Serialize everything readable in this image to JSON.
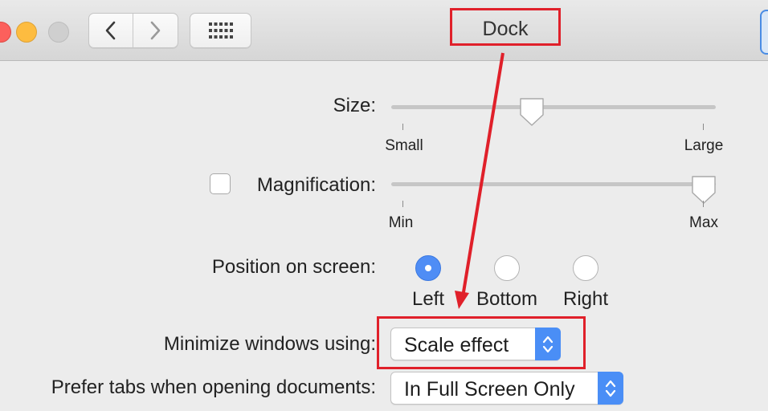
{
  "window": {
    "title": "Dock"
  },
  "toolbar": {
    "back_icon": "chevron-left-icon",
    "forward_icon": "chevron-right-icon",
    "show_all_icon": "grid-icon"
  },
  "settings": {
    "size": {
      "label": "Size:",
      "min_label": "Small",
      "max_label": "Large",
      "value": 0.43
    },
    "magnification": {
      "label": "Magnification:",
      "checked": false,
      "min_label": "Min",
      "max_label": "Max",
      "value": 1.0
    },
    "position": {
      "label": "Position on screen:",
      "options": [
        "Left",
        "Bottom",
        "Right"
      ],
      "selected": "Left"
    },
    "minimize": {
      "label": "Minimize windows using:",
      "value": "Scale effect"
    },
    "prefer_tabs": {
      "label": "Prefer tabs when opening documents:",
      "value": "In Full Screen Only"
    }
  },
  "colors": {
    "annotation": "#e0202a",
    "accent": "#4a8ef6"
  }
}
